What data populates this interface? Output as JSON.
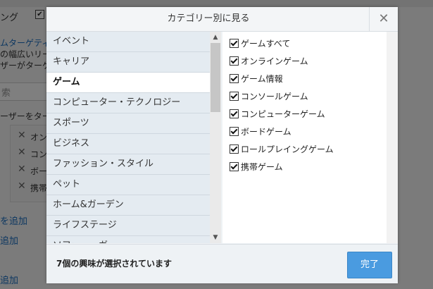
{
  "background": {
    "topleft_text": "ング",
    "checkbox_tick": "✔",
    "line1": "ムターゲティ",
    "line2": "の幅広いリー",
    "line3": "ザーがターゲ",
    "search_placeholder": "索",
    "line4": "ーザーをター",
    "keyword1": "オン",
    "keyword2": "コン",
    "keyword3": "ボー",
    "keyword4": "携帯",
    "link1": "を追加",
    "link2": "追加",
    "link3": "追加",
    "remove_glyph": "✕"
  },
  "dialog": {
    "title": "カテゴリー別に見る",
    "close_glyph": "✕",
    "categories": [
      {
        "label": "イベント"
      },
      {
        "label": "キャリア"
      },
      {
        "label": "ゲーム"
      },
      {
        "label": "コンピューター・テクノロジー"
      },
      {
        "label": "スポーツ"
      },
      {
        "label": "ビジネス"
      },
      {
        "label": "ファッション・スタイル"
      },
      {
        "label": "ペット"
      },
      {
        "label": "ホーム&ガーデン"
      },
      {
        "label": "ライフステージ"
      },
      {
        "label": "ソファー・ガ"
      }
    ],
    "selected_category": "ゲーム",
    "scroll_up": "▲",
    "scroll_down": "▼",
    "options": [
      {
        "label": "ゲームすべて",
        "checked": true
      },
      {
        "label": "オンラインゲーム",
        "checked": true
      },
      {
        "label": "ゲーム情報",
        "checked": true
      },
      {
        "label": "コンソールゲーム",
        "checked": true
      },
      {
        "label": "コンピューターゲーム",
        "checked": true
      },
      {
        "label": "ボードゲーム",
        "checked": true
      },
      {
        "label": "ロールプレイングゲーム",
        "checked": true
      },
      {
        "label": "携帯ゲーム",
        "checked": true
      }
    ],
    "selection_count_text": "7個の興味が選択されています",
    "done_label": "完了"
  },
  "colors": {
    "accent": "#4a9be0",
    "link": "#1b6fc2"
  }
}
